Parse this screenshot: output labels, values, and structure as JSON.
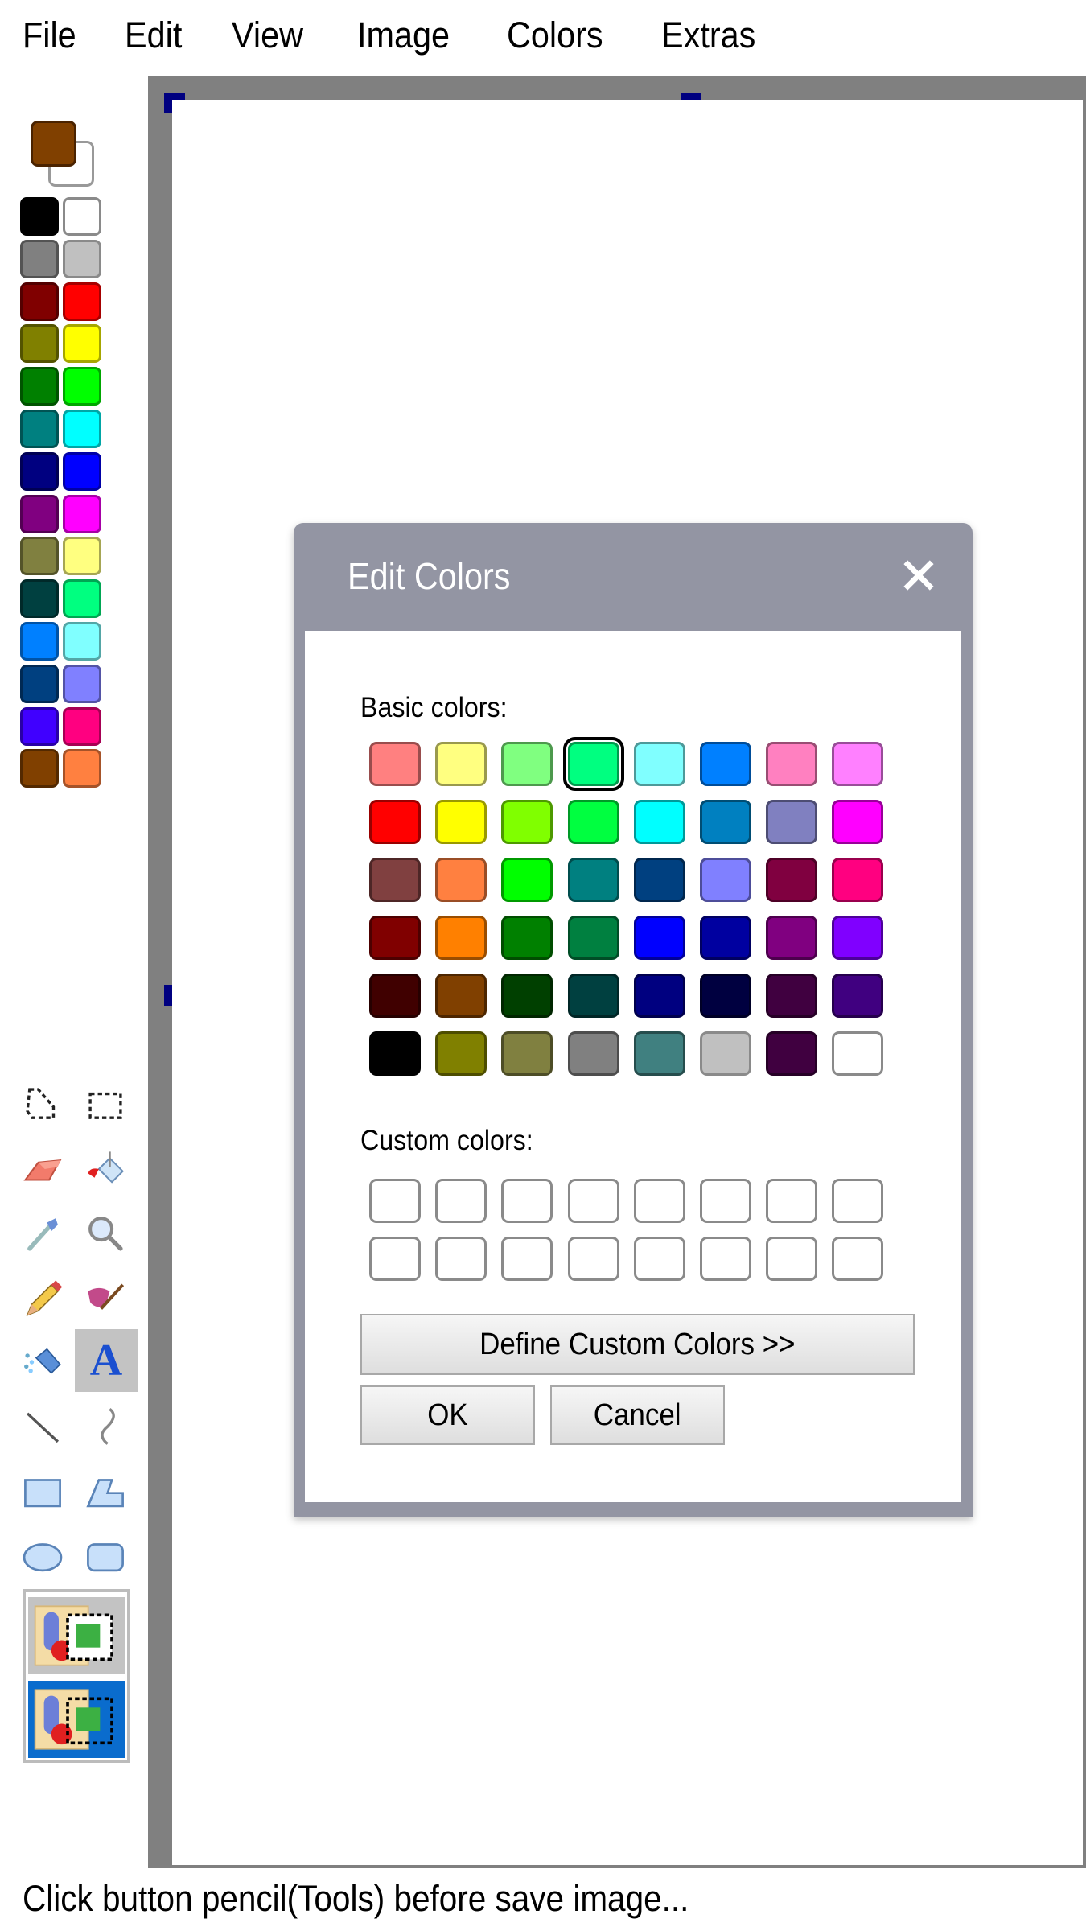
{
  "menu": [
    "File",
    "Edit",
    "View",
    "Image",
    "Colors",
    "Extras"
  ],
  "palette": {
    "primary_color": "#804000",
    "secondary_color": "#ffffff",
    "swatches": [
      [
        "#000000",
        "#ffffff"
      ],
      [
        "#808080",
        "#c0c0c0"
      ],
      [
        "#800000",
        "#ff0000"
      ],
      [
        "#808000",
        "#ffff00"
      ],
      [
        "#008000",
        "#00ff00"
      ],
      [
        "#008080",
        "#00ffff"
      ],
      [
        "#000080",
        "#0000ff"
      ],
      [
        "#800080",
        "#ff00ff"
      ],
      [
        "#808040",
        "#ffff80"
      ],
      [
        "#004040",
        "#00ff80"
      ],
      [
        "#0080ff",
        "#80ffff"
      ],
      [
        "#004080",
        "#8080ff"
      ],
      [
        "#4000ff",
        "#ff0080"
      ],
      [
        "#804000",
        "#ff8040"
      ]
    ]
  },
  "tools": [
    {
      "name": "free-form-select",
      "icon": "free-select-icon"
    },
    {
      "name": "rect-select",
      "icon": "rect-select-icon"
    },
    {
      "name": "eraser",
      "icon": "eraser-icon"
    },
    {
      "name": "fill",
      "icon": "paint-bucket-icon"
    },
    {
      "name": "pick-color",
      "icon": "eyedropper-icon"
    },
    {
      "name": "magnifier",
      "icon": "magnifier-icon"
    },
    {
      "name": "pencil",
      "icon": "pencil-icon"
    },
    {
      "name": "brush",
      "icon": "brush-icon"
    },
    {
      "name": "airbrush",
      "icon": "airbrush-icon"
    },
    {
      "name": "text",
      "icon": "text-icon",
      "glyph": "A",
      "active": true
    },
    {
      "name": "line",
      "icon": "line-icon"
    },
    {
      "name": "curve",
      "icon": "curve-icon"
    },
    {
      "name": "rectangle",
      "icon": "rectangle-icon"
    },
    {
      "name": "polygon",
      "icon": "polygon-icon"
    },
    {
      "name": "ellipse",
      "icon": "ellipse-icon"
    },
    {
      "name": "rounded-rectangle",
      "icon": "rounded-rectangle-icon"
    }
  ],
  "tool_options": [
    {
      "name": "opaque",
      "selected": false
    },
    {
      "name": "transparent",
      "selected": true
    }
  ],
  "dialog": {
    "title": "Edit Colors",
    "close_icon": "close-icon",
    "basic_label": "Basic colors:",
    "basic_colors": [
      [
        "#ff8080",
        "#ffff80",
        "#80ff80",
        "#00ff80",
        "#80ffff",
        "#0080ff",
        "#ff80c0",
        "#ff80ff"
      ],
      [
        "#ff0000",
        "#ffff00",
        "#80ff00",
        "#00ff40",
        "#00ffff",
        "#0080c0",
        "#8080c0",
        "#ff00ff"
      ],
      [
        "#804040",
        "#ff8040",
        "#00ff00",
        "#008080",
        "#004080",
        "#8080ff",
        "#800040",
        "#ff0080"
      ],
      [
        "#800000",
        "#ff8000",
        "#008000",
        "#008040",
        "#0000ff",
        "#0000a0",
        "#800080",
        "#8000ff"
      ],
      [
        "#400000",
        "#804000",
        "#004000",
        "#004040",
        "#000080",
        "#000040",
        "#400040",
        "#400080"
      ],
      [
        "#000000",
        "#808000",
        "#808040",
        "#808080",
        "#408080",
        "#c0c0c0",
        "#400040",
        "#ffffff"
      ]
    ],
    "selected_basic": [
      0,
      3
    ],
    "custom_label": "Custom colors:",
    "custom_rows": 2,
    "custom_cols": 8,
    "define_button": "Define Custom Colors >>",
    "ok_button": "OK",
    "cancel_button": "Cancel"
  },
  "status": "Click button pencil(Tools) before save image..."
}
